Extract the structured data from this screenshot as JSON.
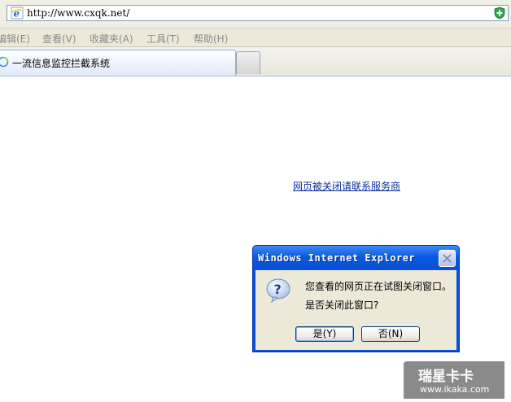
{
  "address_bar": {
    "url": "http://www.cxqk.net/"
  },
  "menu": {
    "items": [
      "编辑(E)",
      "查看(V)",
      "收藏夹(A)",
      "工具(T)",
      "帮助(H)"
    ]
  },
  "tabs": {
    "active_title": "一流信息监控拦截系统"
  },
  "page": {
    "link_text": "网页被关闭请联系服务商"
  },
  "dialog": {
    "title": "Windows Internet Explorer",
    "message_line1": "您查看的网页正在试图关闭窗口。",
    "message_line2": "是否关闭此窗口?",
    "yes_label": "是(Y)",
    "no_label": "否(N)"
  },
  "watermark": {
    "line1": "瑞星卡卡",
    "line2": "www.ikaka.com"
  },
  "colors": {
    "dialog_titlebar": "#0b5ae0",
    "link": "#0b2f9b",
    "menubar": "#ece9d8"
  }
}
